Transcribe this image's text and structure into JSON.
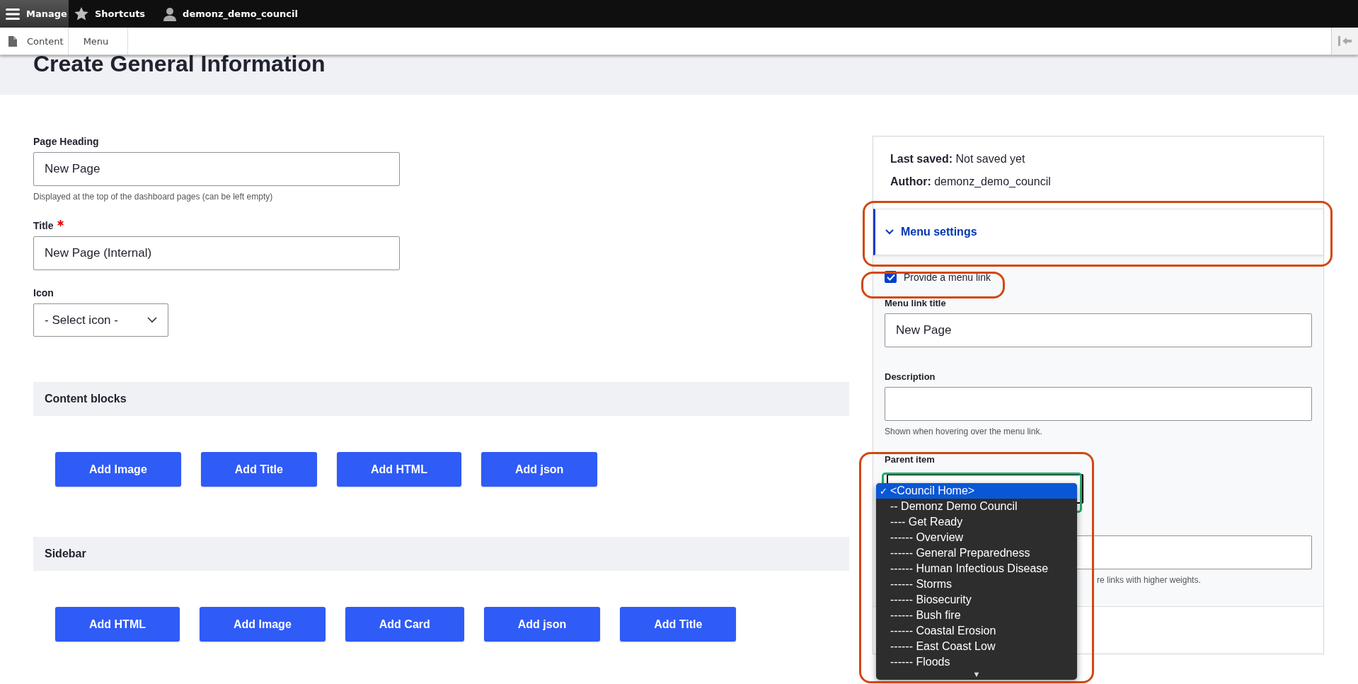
{
  "toolbar": {
    "items": [
      {
        "kind": "menu",
        "label": "Manage",
        "selected": true
      },
      {
        "kind": "star",
        "label": "Shortcuts",
        "selected": false
      },
      {
        "kind": "user",
        "label": "demonz_demo_council",
        "selected": false
      }
    ]
  },
  "tray": {
    "tabs": [
      {
        "kind": "file",
        "label": "Content"
      },
      {
        "kind": "none",
        "label": "Menu"
      }
    ]
  },
  "page_title": "Create General Information",
  "form": {
    "page_heading": {
      "label": "Page Heading",
      "value": "New Page",
      "hint": "Displayed at the top of the dashboard pages (can be left empty)"
    },
    "title": {
      "label": "Title",
      "required": true,
      "value": "New Page (Internal)"
    },
    "icon": {
      "label": "Icon",
      "value": "- Select icon -"
    },
    "sections": [
      {
        "title": "Content blocks",
        "buttons": [
          "Add Image",
          "Add Title",
          "Add HTML",
          "Add json"
        ]
      },
      {
        "title": "Sidebar",
        "buttons": [
          "Add HTML",
          "Add Image",
          "Add Card",
          "Add json",
          "Add Title"
        ]
      }
    ]
  },
  "meta": {
    "last_saved_label": "Last saved:",
    "last_saved": "Not saved yet",
    "author_label": "Author:",
    "author": "demonz_demo_council"
  },
  "menu_settings": {
    "title": "Menu settings",
    "expanded": true,
    "provide_link": {
      "label": "Provide a menu link",
      "checked": true
    },
    "link_title": {
      "label": "Menu link title",
      "value": "New Page"
    },
    "description": {
      "label": "Description",
      "hint": "Shown when hovering over the menu link."
    },
    "parent_item": {
      "label": "Parent item",
      "options": [
        {
          "label": "<Council Home>",
          "selected": true
        },
        {
          "label": "-- Demonz Demo Council",
          "selected": false
        },
        {
          "label": "---- Get Ready",
          "selected": false
        },
        {
          "label": "------ Overview",
          "selected": false
        },
        {
          "label": "------ General Preparedness",
          "selected": false
        },
        {
          "label": "------ Human Infectious Disease",
          "selected": false
        },
        {
          "label": "------ Storms",
          "selected": false
        },
        {
          "label": "------ Biosecurity",
          "selected": false
        },
        {
          "label": "------ Bush fire",
          "selected": false
        },
        {
          "label": "------ Coastal Erosion",
          "selected": false
        },
        {
          "label": "------ East Coast Low",
          "selected": false
        },
        {
          "label": "------ Floods",
          "selected": false
        }
      ],
      "check_mark": "✓",
      "more_arrow": "▼"
    },
    "weight_hint": "re links with higher weights."
  }
}
